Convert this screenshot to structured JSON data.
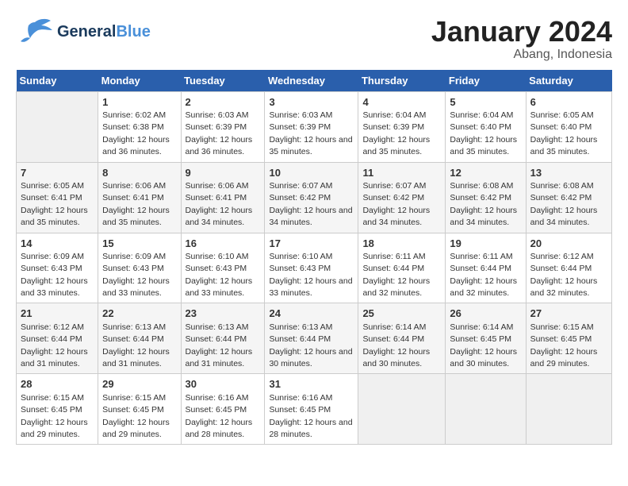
{
  "header": {
    "logo_general": "General",
    "logo_blue": "Blue",
    "title": "January 2024",
    "subtitle": "Abang, Indonesia"
  },
  "weekdays": [
    "Sunday",
    "Monday",
    "Tuesday",
    "Wednesday",
    "Thursday",
    "Friday",
    "Saturday"
  ],
  "weeks": [
    [
      {
        "day": "",
        "sunrise": "",
        "sunset": "",
        "daylight": ""
      },
      {
        "day": "1",
        "sunrise": "Sunrise: 6:02 AM",
        "sunset": "Sunset: 6:38 PM",
        "daylight": "Daylight: 12 hours and 36 minutes."
      },
      {
        "day": "2",
        "sunrise": "Sunrise: 6:03 AM",
        "sunset": "Sunset: 6:39 PM",
        "daylight": "Daylight: 12 hours and 36 minutes."
      },
      {
        "day": "3",
        "sunrise": "Sunrise: 6:03 AM",
        "sunset": "Sunset: 6:39 PM",
        "daylight": "Daylight: 12 hours and 35 minutes."
      },
      {
        "day": "4",
        "sunrise": "Sunrise: 6:04 AM",
        "sunset": "Sunset: 6:39 PM",
        "daylight": "Daylight: 12 hours and 35 minutes."
      },
      {
        "day": "5",
        "sunrise": "Sunrise: 6:04 AM",
        "sunset": "Sunset: 6:40 PM",
        "daylight": "Daylight: 12 hours and 35 minutes."
      },
      {
        "day": "6",
        "sunrise": "Sunrise: 6:05 AM",
        "sunset": "Sunset: 6:40 PM",
        "daylight": "Daylight: 12 hours and 35 minutes."
      }
    ],
    [
      {
        "day": "7",
        "sunrise": "Sunrise: 6:05 AM",
        "sunset": "Sunset: 6:41 PM",
        "daylight": "Daylight: 12 hours and 35 minutes."
      },
      {
        "day": "8",
        "sunrise": "Sunrise: 6:06 AM",
        "sunset": "Sunset: 6:41 PM",
        "daylight": "Daylight: 12 hours and 35 minutes."
      },
      {
        "day": "9",
        "sunrise": "Sunrise: 6:06 AM",
        "sunset": "Sunset: 6:41 PM",
        "daylight": "Daylight: 12 hours and 34 minutes."
      },
      {
        "day": "10",
        "sunrise": "Sunrise: 6:07 AM",
        "sunset": "Sunset: 6:42 PM",
        "daylight": "Daylight: 12 hours and 34 minutes."
      },
      {
        "day": "11",
        "sunrise": "Sunrise: 6:07 AM",
        "sunset": "Sunset: 6:42 PM",
        "daylight": "Daylight: 12 hours and 34 minutes."
      },
      {
        "day": "12",
        "sunrise": "Sunrise: 6:08 AM",
        "sunset": "Sunset: 6:42 PM",
        "daylight": "Daylight: 12 hours and 34 minutes."
      },
      {
        "day": "13",
        "sunrise": "Sunrise: 6:08 AM",
        "sunset": "Sunset: 6:42 PM",
        "daylight": "Daylight: 12 hours and 34 minutes."
      }
    ],
    [
      {
        "day": "14",
        "sunrise": "Sunrise: 6:09 AM",
        "sunset": "Sunset: 6:43 PM",
        "daylight": "Daylight: 12 hours and 33 minutes."
      },
      {
        "day": "15",
        "sunrise": "Sunrise: 6:09 AM",
        "sunset": "Sunset: 6:43 PM",
        "daylight": "Daylight: 12 hours and 33 minutes."
      },
      {
        "day": "16",
        "sunrise": "Sunrise: 6:10 AM",
        "sunset": "Sunset: 6:43 PM",
        "daylight": "Daylight: 12 hours and 33 minutes."
      },
      {
        "day": "17",
        "sunrise": "Sunrise: 6:10 AM",
        "sunset": "Sunset: 6:43 PM",
        "daylight": "Daylight: 12 hours and 33 minutes."
      },
      {
        "day": "18",
        "sunrise": "Sunrise: 6:11 AM",
        "sunset": "Sunset: 6:44 PM",
        "daylight": "Daylight: 12 hours and 32 minutes."
      },
      {
        "day": "19",
        "sunrise": "Sunrise: 6:11 AM",
        "sunset": "Sunset: 6:44 PM",
        "daylight": "Daylight: 12 hours and 32 minutes."
      },
      {
        "day": "20",
        "sunrise": "Sunrise: 6:12 AM",
        "sunset": "Sunset: 6:44 PM",
        "daylight": "Daylight: 12 hours and 32 minutes."
      }
    ],
    [
      {
        "day": "21",
        "sunrise": "Sunrise: 6:12 AM",
        "sunset": "Sunset: 6:44 PM",
        "daylight": "Daylight: 12 hours and 31 minutes."
      },
      {
        "day": "22",
        "sunrise": "Sunrise: 6:13 AM",
        "sunset": "Sunset: 6:44 PM",
        "daylight": "Daylight: 12 hours and 31 minutes."
      },
      {
        "day": "23",
        "sunrise": "Sunrise: 6:13 AM",
        "sunset": "Sunset: 6:44 PM",
        "daylight": "Daylight: 12 hours and 31 minutes."
      },
      {
        "day": "24",
        "sunrise": "Sunrise: 6:13 AM",
        "sunset": "Sunset: 6:44 PM",
        "daylight": "Daylight: 12 hours and 30 minutes."
      },
      {
        "day": "25",
        "sunrise": "Sunrise: 6:14 AM",
        "sunset": "Sunset: 6:44 PM",
        "daylight": "Daylight: 12 hours and 30 minutes."
      },
      {
        "day": "26",
        "sunrise": "Sunrise: 6:14 AM",
        "sunset": "Sunset: 6:45 PM",
        "daylight": "Daylight: 12 hours and 30 minutes."
      },
      {
        "day": "27",
        "sunrise": "Sunrise: 6:15 AM",
        "sunset": "Sunset: 6:45 PM",
        "daylight": "Daylight: 12 hours and 29 minutes."
      }
    ],
    [
      {
        "day": "28",
        "sunrise": "Sunrise: 6:15 AM",
        "sunset": "Sunset: 6:45 PM",
        "daylight": "Daylight: 12 hours and 29 minutes."
      },
      {
        "day": "29",
        "sunrise": "Sunrise: 6:15 AM",
        "sunset": "Sunset: 6:45 PM",
        "daylight": "Daylight: 12 hours and 29 minutes."
      },
      {
        "day": "30",
        "sunrise": "Sunrise: 6:16 AM",
        "sunset": "Sunset: 6:45 PM",
        "daylight": "Daylight: 12 hours and 28 minutes."
      },
      {
        "day": "31",
        "sunrise": "Sunrise: 6:16 AM",
        "sunset": "Sunset: 6:45 PM",
        "daylight": "Daylight: 12 hours and 28 minutes."
      },
      {
        "day": "",
        "sunrise": "",
        "sunset": "",
        "daylight": ""
      },
      {
        "day": "",
        "sunrise": "",
        "sunset": "",
        "daylight": ""
      },
      {
        "day": "",
        "sunrise": "",
        "sunset": "",
        "daylight": ""
      }
    ]
  ]
}
